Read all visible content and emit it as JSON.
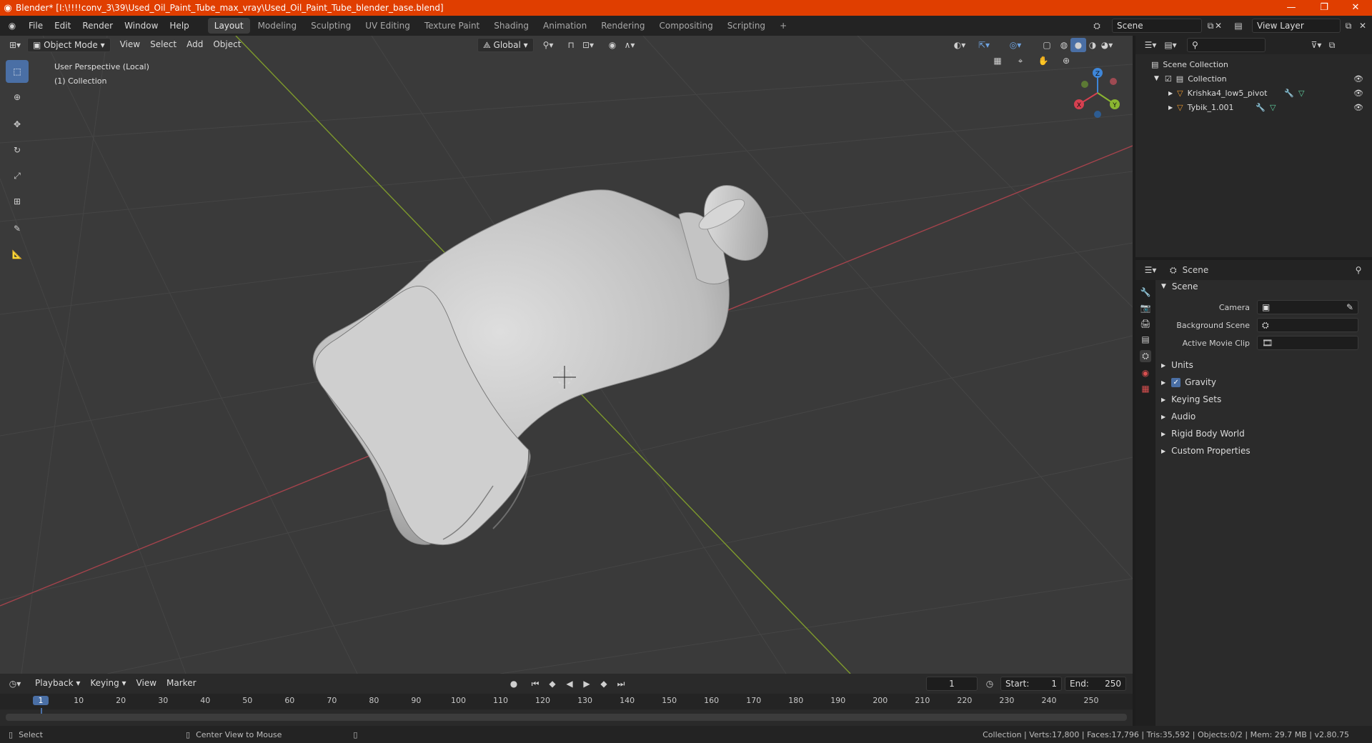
{
  "window": {
    "title": "Blender* [I:\\!!!!conv_3\\39\\Used_Oil_Paint_Tube_max_vray\\Used_Oil_Paint_Tube_blender_base.blend]"
  },
  "menu": [
    "File",
    "Edit",
    "Render",
    "Window",
    "Help"
  ],
  "workspaces": [
    "Layout",
    "Modeling",
    "Sculpting",
    "UV Editing",
    "Texture Paint",
    "Shading",
    "Animation",
    "Rendering",
    "Compositing",
    "Scripting"
  ],
  "scene_field": "Scene",
  "view_layer_field": "View Layer",
  "viewport_header": {
    "mode": "Object Mode",
    "menus": [
      "View",
      "Select",
      "Add",
      "Object"
    ],
    "transform": "Global"
  },
  "viewport_overlay": {
    "perspective": "User Perspective (Local)",
    "collection": "(1) Collection"
  },
  "gizmo": {
    "z": "Z",
    "x": "X",
    "y": "Y"
  },
  "outliner": {
    "root": "Scene Collection",
    "collection": "Collection",
    "objects": [
      "Krishka4_low5_pivot",
      "Tybik_1.001"
    ]
  },
  "properties": {
    "context": "Scene",
    "panel_scene": "Scene",
    "camera_label": "Camera",
    "background_label": "Background Scene",
    "movieclip_label": "Active Movie Clip",
    "subpanels": [
      "Units",
      "Gravity",
      "Keying Sets",
      "Audio",
      "Rigid Body World",
      "Custom Properties"
    ]
  },
  "timeline": {
    "menus": [
      "Playback",
      "Keying",
      "View",
      "Marker"
    ],
    "current_frame": "1",
    "start_label": "Start:",
    "start": "1",
    "end_label": "End:",
    "end": "250",
    "ruler": [
      "1",
      "10",
      "20",
      "30",
      "40",
      "50",
      "60",
      "70",
      "80",
      "90",
      "100",
      "110",
      "120",
      "130",
      "140",
      "150",
      "160",
      "170",
      "180",
      "190",
      "200",
      "210",
      "220",
      "230",
      "240",
      "250"
    ]
  },
  "statusbar": {
    "left1": "Select",
    "left2": "Center View to Mouse",
    "right": "Collection | Verts:17,800 | Faces:17,796 | Tris:35,592 | Objects:0/2 | Mem: 29.7 MB | v2.80.75"
  },
  "colors": {
    "titlebar": "#e03e00",
    "accent": "#4a6fa5",
    "x_axis": "#d64050",
    "y_axis": "#8ab531",
    "z_axis": "#3e86d8"
  }
}
